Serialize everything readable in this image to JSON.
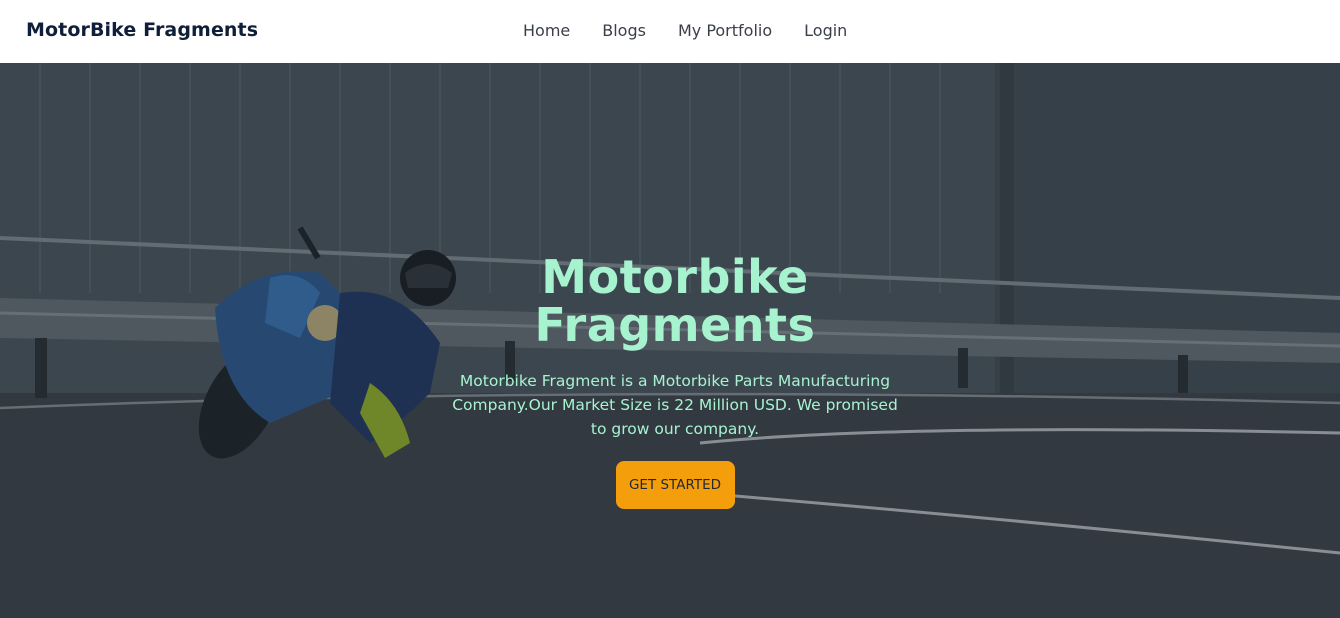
{
  "navbar": {
    "brand": "MotorBike Fragments",
    "links": [
      "Home",
      "Blogs",
      "My Portfolio",
      "Login"
    ]
  },
  "hero": {
    "title_line1": "Motorbike",
    "title_line2": "Fragments",
    "description": "Motorbike Fragment is a Motorbike Parts Manufacturing Company.Our Market Size is 22 Million USD. We promised to grow our company.",
    "cta_label": "GET STARTED"
  },
  "colors": {
    "accent_text": "#a7f3d0",
    "cta_bg": "#f59e0b",
    "brand": "#0f1f3a"
  }
}
